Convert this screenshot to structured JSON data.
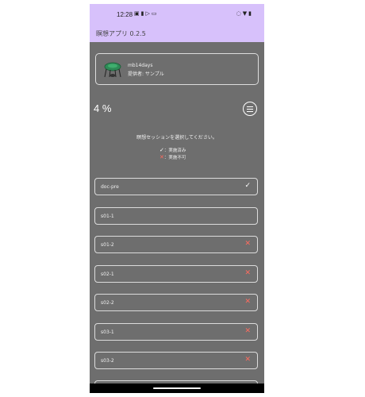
{
  "status_bar": {
    "time": "12:28",
    "left_icons": [
      "notification-icon",
      "alert-icon",
      "play-icon",
      "message-icon"
    ],
    "right_icons": [
      "mute-icon",
      "wifi-icon",
      "battery-icon"
    ]
  },
  "app_bar": {
    "title": "瞑想アプリ 0.2.5"
  },
  "provider": {
    "name": "mb14days",
    "provided_by": "提供者: サンプル"
  },
  "progress": {
    "percent_label": "4 %",
    "percent": 4
  },
  "instruction": "瞑想セッションを選択してください。",
  "legend": {
    "done_icon": "✓",
    "done_label": "：実施済み",
    "unavailable_icon": "✕",
    "unavailable_label": "：実施不可"
  },
  "sessions": [
    {
      "label": "doc-pre",
      "status": "done",
      "icon": "✓"
    },
    {
      "label": "s01-1",
      "status": "none",
      "icon": ""
    },
    {
      "label": "s01-2",
      "status": "unavailable",
      "icon": "✕"
    },
    {
      "label": "s02-1",
      "status": "unavailable",
      "icon": "✕"
    },
    {
      "label": "s02-2",
      "status": "unavailable",
      "icon": "✕"
    },
    {
      "label": "s03-1",
      "status": "unavailable",
      "icon": "✕"
    },
    {
      "label": "s03-2",
      "status": "unavailable",
      "icon": "✕"
    }
  ],
  "colors": {
    "app_bar": "#d7c1fb",
    "background": "#6e6e6e",
    "done": "#ffffff",
    "unavailable": "#ff6b5e"
  }
}
